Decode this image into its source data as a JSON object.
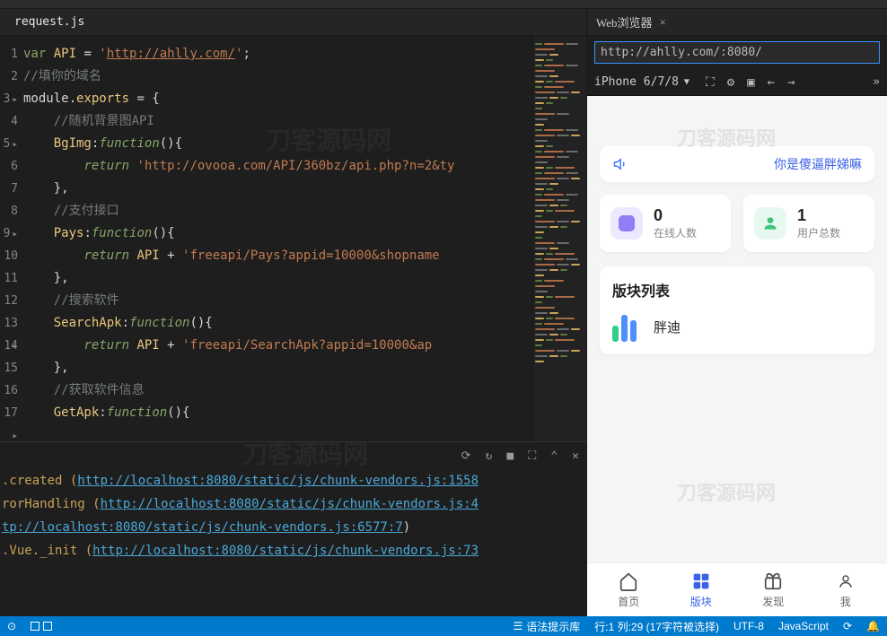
{
  "editor": {
    "filename": "request.js",
    "watermark": "刀客源码网",
    "lines": [
      {
        "n": "1",
        "segs": [
          {
            "t": "var ",
            "c": "kw-var"
          },
          {
            "t": "API ",
            "c": "api-name"
          },
          {
            "t": "= ",
            "c": "punct"
          },
          {
            "t": "'",
            "c": "string"
          },
          {
            "t": "http://ahlly.com/",
            "c": "string-url"
          },
          {
            "t": "'",
            "c": "string"
          },
          {
            "t": ";",
            "c": "punct"
          }
        ]
      },
      {
        "n": "2",
        "segs": [
          {
            "t": "//填你的域名",
            "c": "comment"
          }
        ]
      },
      {
        "n": "3",
        "fold": true,
        "segs": [
          {
            "t": "module",
            "c": "ident"
          },
          {
            "t": ".",
            "c": "punct"
          },
          {
            "t": "exports ",
            "c": "api-name"
          },
          {
            "t": "= {",
            "c": "punct"
          }
        ]
      },
      {
        "n": "4",
        "segs": [
          {
            "t": "    ",
            "c": "ident"
          },
          {
            "t": "//随机背景图API",
            "c": "comment"
          }
        ]
      },
      {
        "n": "5",
        "fold": true,
        "segs": [
          {
            "t": "    ",
            "c": "ident"
          },
          {
            "t": "BgImg",
            "c": "api-name"
          },
          {
            "t": ":",
            "c": "punct"
          },
          {
            "t": "function",
            "c": "kw-func"
          },
          {
            "t": "(){",
            "c": "punct"
          }
        ]
      },
      {
        "n": "6",
        "segs": [
          {
            "t": "        ",
            "c": "ident"
          },
          {
            "t": "return ",
            "c": "ret"
          },
          {
            "t": "'http://ovooa.com/API/360bz/api.php?n=2&ty",
            "c": "string"
          }
        ]
      },
      {
        "n": "7",
        "segs": [
          {
            "t": "    },",
            "c": "punct"
          }
        ]
      },
      {
        "n": "8",
        "segs": [
          {
            "t": "    ",
            "c": "ident"
          },
          {
            "t": "//支付接口",
            "c": "comment"
          }
        ]
      },
      {
        "n": "9",
        "fold": true,
        "segs": [
          {
            "t": "    ",
            "c": "ident"
          },
          {
            "t": "Pays",
            "c": "api-name"
          },
          {
            "t": ":",
            "c": "punct"
          },
          {
            "t": "function",
            "c": "kw-func"
          },
          {
            "t": "(){",
            "c": "punct"
          }
        ]
      },
      {
        "n": "10",
        "segs": [
          {
            "t": "        ",
            "c": "ident"
          },
          {
            "t": "return ",
            "c": "ret"
          },
          {
            "t": "API ",
            "c": "api-name"
          },
          {
            "t": "+ ",
            "c": "punct"
          },
          {
            "t": "'freeapi/Pays?appid=10000&shopname",
            "c": "string"
          }
        ]
      },
      {
        "n": "11",
        "segs": [
          {
            "t": "    },",
            "c": "punct"
          }
        ]
      },
      {
        "n": "12",
        "segs": [
          {
            "t": "    ",
            "c": "ident"
          },
          {
            "t": "//搜索软件",
            "c": "comment"
          }
        ]
      },
      {
        "n": "13",
        "fold": true,
        "segs": [
          {
            "t": "    ",
            "c": "ident"
          },
          {
            "t": "SearchApk",
            "c": "api-name"
          },
          {
            "t": ":",
            "c": "punct"
          },
          {
            "t": "function",
            "c": "kw-func"
          },
          {
            "t": "(){",
            "c": "punct"
          }
        ]
      },
      {
        "n": "14",
        "segs": [
          {
            "t": "        ",
            "c": "ident"
          },
          {
            "t": "return ",
            "c": "ret"
          },
          {
            "t": "API ",
            "c": "api-name"
          },
          {
            "t": "+ ",
            "c": "punct"
          },
          {
            "t": "'freeapi/SearchApk?appid=10000&ap",
            "c": "string"
          }
        ]
      },
      {
        "n": "15",
        "segs": [
          {
            "t": "    },",
            "c": "punct"
          }
        ]
      },
      {
        "n": "16",
        "segs": [
          {
            "t": "    ",
            "c": "ident"
          },
          {
            "t": "//获取软件信息",
            "c": "comment"
          }
        ]
      },
      {
        "n": "17",
        "fold": true,
        "segs": [
          {
            "t": "    ",
            "c": "ident"
          },
          {
            "t": "GetApk",
            "c": "api-name"
          },
          {
            "t": ":",
            "c": "punct"
          },
          {
            "t": "function",
            "c": "kw-func"
          },
          {
            "t": "(){",
            "c": "punct"
          }
        ]
      }
    ]
  },
  "terminal": {
    "icons": [
      "⟳",
      "↻",
      "■",
      "⬚",
      "⌃",
      "✕"
    ],
    "lines": [
      [
        {
          "t": ".created (",
          "c": "term-yellow"
        },
        {
          "t": "http://localhost:8080/static/js/chunk-vendors.js:1558",
          "c": "term-link"
        }
      ],
      [
        {
          "t": "",
          "c": ""
        }
      ],
      [
        {
          "t": "rorHandling (",
          "c": "term-yellow"
        },
        {
          "t": "http://localhost:8080/static/js/chunk-vendors.js:4",
          "c": "term-link"
        }
      ],
      [
        {
          "t": "",
          "c": ""
        }
      ],
      [
        {
          "t": "tp://localhost:8080/static/js/chunk-vendors.js:6577:7",
          "c": "term-link"
        },
        {
          "t": ")",
          "c": "term-white"
        }
      ],
      [
        {
          "t": ".Vue._init (",
          "c": "term-yellow"
        },
        {
          "t": "http://localhost:8080/static/js/chunk-vendors.js:73",
          "c": "term-link"
        }
      ]
    ]
  },
  "browser": {
    "tab_title": "Web浏览器",
    "url": "http://ahlly.com/:8080/",
    "device": "iPhone 6/7/8",
    "watermark": "刀客源码网"
  },
  "preview": {
    "notice_text": "你是傻逼胖娣嘛",
    "stats": [
      {
        "value": "0",
        "label": "在线人数",
        "icon": "purple"
      },
      {
        "value": "1",
        "label": "用户总数",
        "icon": "green"
      }
    ],
    "section_title": "版块列表",
    "section_item": "胖迪",
    "nav": [
      {
        "label": "首页",
        "icon": "home"
      },
      {
        "label": "版块",
        "icon": "grid",
        "active": true
      },
      {
        "label": "发现",
        "icon": "gift"
      },
      {
        "label": "我",
        "icon": "person"
      }
    ]
  },
  "status": {
    "syntax": "语法提示库",
    "cursor": "行:1  列:29 (17字符被选择)",
    "encoding": "UTF-8",
    "lang": "JavaScript"
  }
}
